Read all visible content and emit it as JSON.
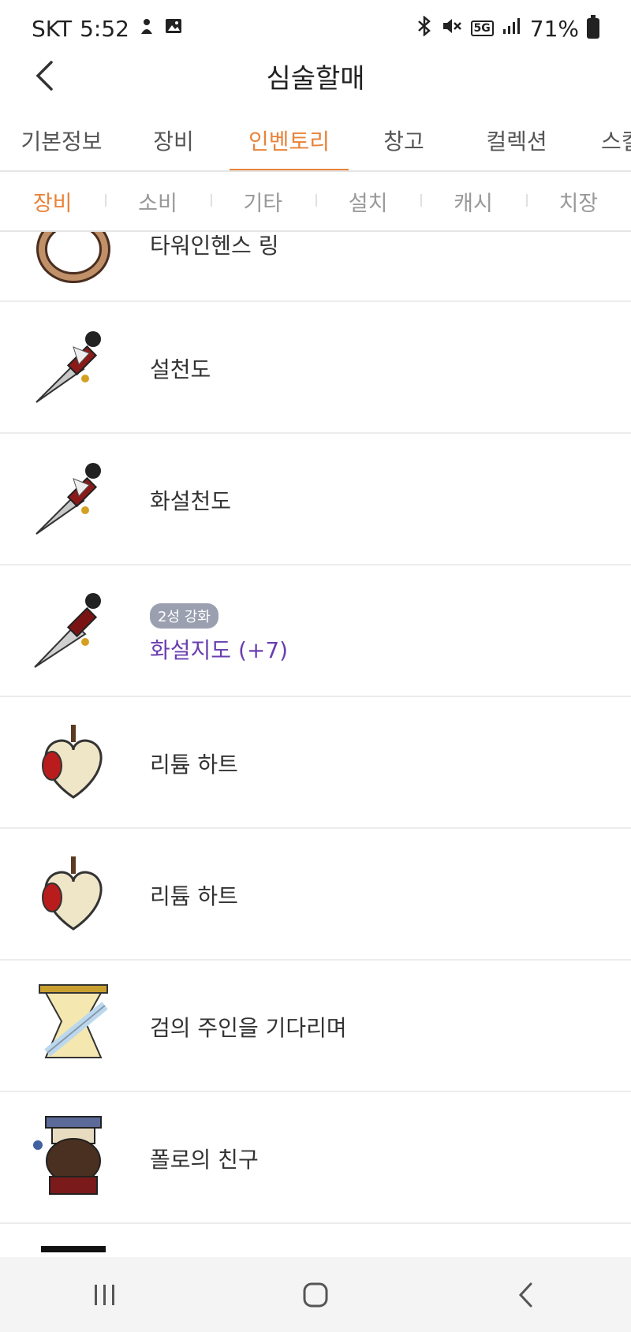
{
  "status": {
    "carrier": "SKT",
    "time": "5:52",
    "network": "5G",
    "battery": "71%"
  },
  "header": {
    "title": "심술할매"
  },
  "main_tabs": [
    {
      "label": "기본정보",
      "active": false
    },
    {
      "label": "장비",
      "active": false
    },
    {
      "label": "인벤토리",
      "active": true
    },
    {
      "label": "창고",
      "active": false
    },
    {
      "label": "컬렉션",
      "active": false
    },
    {
      "label": "스킬",
      "active": false
    }
  ],
  "sub_tabs": [
    {
      "label": "장비",
      "active": true
    },
    {
      "label": "소비",
      "active": false
    },
    {
      "label": "기타",
      "active": false
    },
    {
      "label": "설치",
      "active": false
    },
    {
      "label": "캐시",
      "active": false
    },
    {
      "label": "치장",
      "active": false
    }
  ],
  "items": [
    {
      "name": "타워인헨스 링",
      "icon": "ring-icon"
    },
    {
      "name": "설천도",
      "icon": "dagger-icon"
    },
    {
      "name": "화설천도",
      "icon": "dagger-icon"
    },
    {
      "name": "화설지도 (+7)",
      "icon": "dagger-icon",
      "badge": "2성 강화",
      "enhanced": true
    },
    {
      "name": "리튬 하트",
      "icon": "heart-icon"
    },
    {
      "name": "리튬 하트",
      "icon": "heart-icon"
    },
    {
      "name": "검의 주인을 기다리며",
      "icon": "emblem-icon"
    },
    {
      "name": "폴로의 친구",
      "icon": "character-icon"
    }
  ],
  "colors": {
    "accent": "#e8833a",
    "enhanced_text": "#6a3fb0",
    "badge_bg": "#9aa0b0"
  }
}
